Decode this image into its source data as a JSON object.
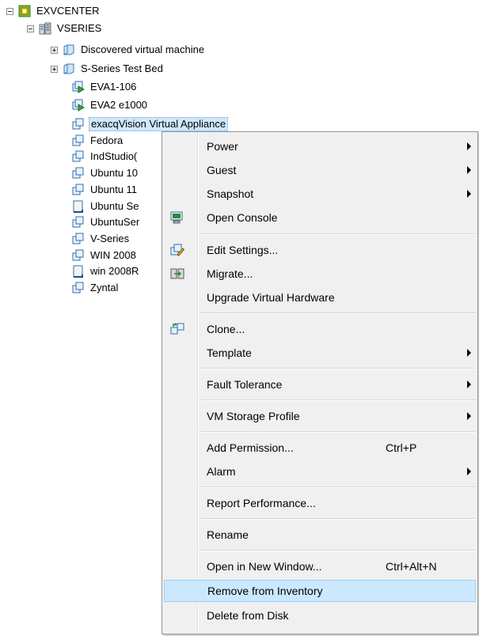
{
  "tree": {
    "root": "EXVCENTER",
    "datacenter": "VSERIES",
    "items": [
      {
        "label": "Discovered virtual machine",
        "kind": "folder"
      },
      {
        "label": "S-Series Test Bed",
        "kind": "folder"
      },
      {
        "label": "EVA1-106",
        "kind": "vm-template"
      },
      {
        "label": "EVA2 e1000",
        "kind": "vm-template"
      },
      {
        "label": "exacqVision Virtual Appliance",
        "kind": "vm"
      },
      {
        "label": "Fedora",
        "kind": "vm"
      },
      {
        "label": "IndStudio(",
        "kind": "vm"
      },
      {
        "label": "Ubuntu 10",
        "kind": "vm"
      },
      {
        "label": "Ubuntu 11",
        "kind": "vm"
      },
      {
        "label": "Ubuntu Se",
        "kind": "vm-off"
      },
      {
        "label": "UbuntuSer",
        "kind": "vm"
      },
      {
        "label": "V-Series",
        "kind": "vm"
      },
      {
        "label": "WIN 2008",
        "kind": "vm"
      },
      {
        "label": "win 2008R",
        "kind": "vm-off"
      },
      {
        "label": "Zyntal",
        "kind": "vm"
      }
    ]
  },
  "menu": {
    "items": [
      {
        "label": "Power",
        "submenu": true
      },
      {
        "label": "Guest",
        "submenu": true
      },
      {
        "label": "Snapshot",
        "submenu": true
      },
      {
        "label": "Open Console",
        "icon": "console-icon"
      },
      {
        "label": "Edit Settings...",
        "icon": "edit-settings-icon"
      },
      {
        "label": "Migrate...",
        "icon": "migrate-icon"
      },
      {
        "label": "Upgrade Virtual Hardware"
      },
      {
        "label": "Clone...",
        "icon": "clone-icon"
      },
      {
        "label": "Template",
        "submenu": true
      },
      {
        "label": "Fault Tolerance",
        "submenu": true
      },
      {
        "label": "VM Storage Profile",
        "submenu": true
      },
      {
        "label": "Add Permission...",
        "shortcut": "Ctrl+P"
      },
      {
        "label": "Alarm",
        "submenu": true
      },
      {
        "label": "Report Performance..."
      },
      {
        "label": "Rename"
      },
      {
        "label": "Open in New Window...",
        "shortcut": "Ctrl+Alt+N"
      },
      {
        "label": "Remove from Inventory",
        "highlighted": true
      },
      {
        "label": "Delete from Disk"
      }
    ]
  }
}
